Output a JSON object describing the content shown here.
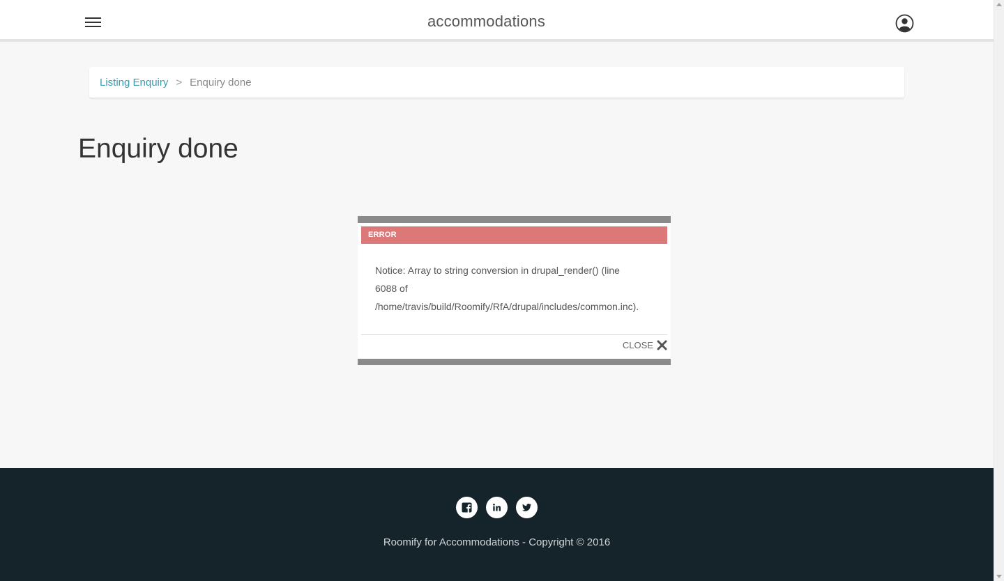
{
  "header": {
    "site_title": "accommodations",
    "menu_icon": "hamburger-menu-icon",
    "user_icon": "user-account-icon"
  },
  "breadcrumb": {
    "link_label": "Listing Enquiry",
    "separator": ">",
    "current": "Enquiry done"
  },
  "main": {
    "page_title": "Enquiry done"
  },
  "modal": {
    "header_label": "ERROR",
    "message_line1": "Notice: Array to string conversion in drupal_render() (line",
    "message_line2": "6088 of",
    "message_line3": "/home/travis/build/Roomify/RfA/drupal/includes/common.inc).",
    "close_label": "CLOSE",
    "close_icon": "close-x-icon",
    "colors": {
      "header_bg": "#dd7878",
      "border": "#8a8a8a"
    }
  },
  "footer": {
    "social": [
      {
        "name": "facebook",
        "icon": "facebook-icon"
      },
      {
        "name": "linkedin",
        "icon": "linkedin-icon"
      },
      {
        "name": "twitter",
        "icon": "twitter-icon"
      }
    ],
    "copyright": "Roomify for Accommodations - Copyright © 2016",
    "colors": {
      "background": "#15242b"
    }
  },
  "colors": {
    "accent_link": "#3a9bb0",
    "page_bg": "#f7f7f7"
  }
}
